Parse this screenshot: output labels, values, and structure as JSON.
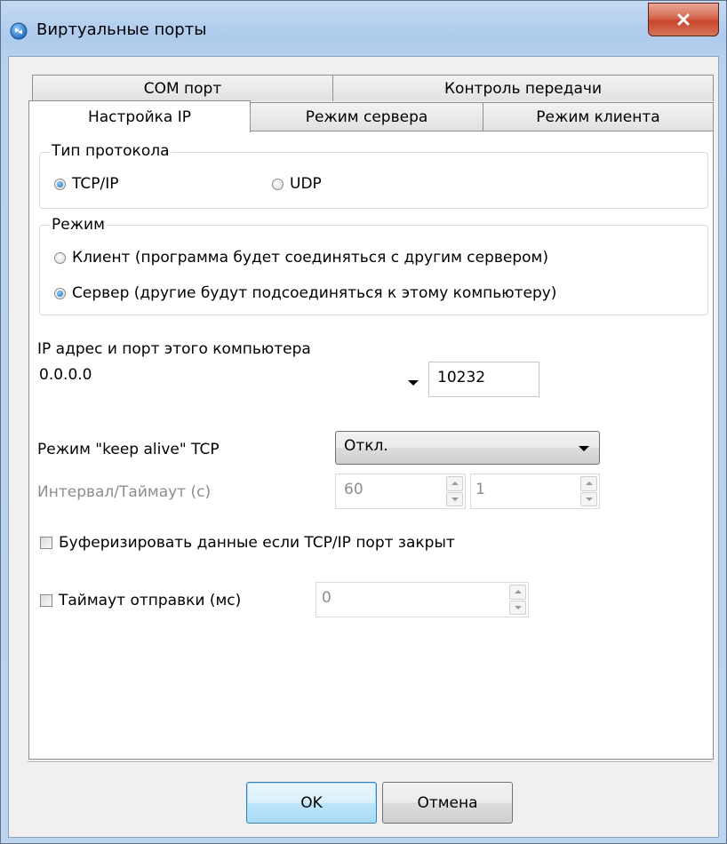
{
  "window": {
    "title": "Виртуальные порты"
  },
  "tabs": {
    "row_back": [
      {
        "label": "COM порт"
      },
      {
        "label": "Контроль передачи"
      }
    ],
    "row_front": [
      {
        "label": "Настройка IP",
        "active": true
      },
      {
        "label": "Режим сервера"
      },
      {
        "label": "Режим клиента"
      }
    ]
  },
  "protocol_group": {
    "title": "Тип протокола",
    "options": [
      {
        "label": "TCP/IP",
        "checked": true
      },
      {
        "label": "UDP",
        "checked": false
      }
    ]
  },
  "mode_group": {
    "title": "Режим",
    "options": [
      {
        "label": "Клиент (программа будет соединяться с другим сервером)",
        "checked": false
      },
      {
        "label": "Сервер (другие будут подсоединяться к этому компьютеру)",
        "checked": true
      }
    ]
  },
  "address": {
    "label": "IP адрес и порт этого компьютера",
    "ip_value": "0.0.0.0",
    "port_value": "10232"
  },
  "keepalive": {
    "label": "Режим \"keep alive\" TCP",
    "selected": "Откл.",
    "interval_label": "Интервал/Таймаут (с)",
    "interval_value": "60",
    "timeout_value": "1"
  },
  "buffer_checkbox": {
    "label": "Буферизировать данные если TCP/IP порт закрыт",
    "checked": false
  },
  "send_timeout": {
    "label": "Таймаут отправки (мс)",
    "checked": false,
    "value": "0"
  },
  "buttons": {
    "ok": "OK",
    "cancel": "Отмена"
  },
  "colors": {
    "titlebar": "#bcd4ef",
    "close_button": "#c8462c",
    "dialog_bg": "#f0f0f0",
    "default_button_border": "#3c7fb1"
  }
}
